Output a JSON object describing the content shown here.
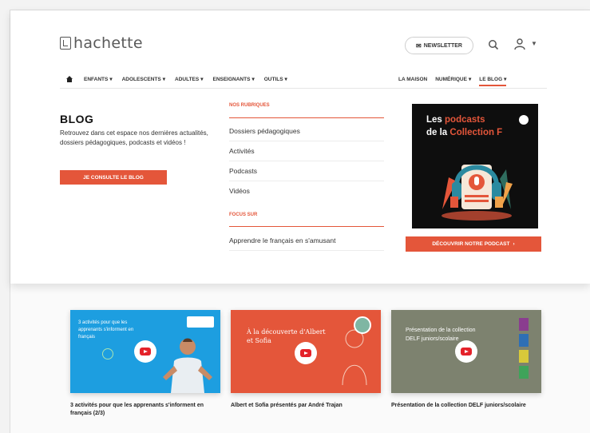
{
  "header": {
    "logo_text": "hachette",
    "newsletter_label": "NEWSLETTER",
    "nav_left": [
      {
        "label": "ENFANTS"
      },
      {
        "label": "ADOLESCENTS"
      },
      {
        "label": "ADULTES"
      },
      {
        "label": "ENSEIGNANTS"
      },
      {
        "label": "OUTILS"
      }
    ],
    "nav_right": [
      {
        "label": "LA MAISON"
      },
      {
        "label": "NUMÉRIQUE"
      },
      {
        "label": "LE BLOG"
      }
    ]
  },
  "mega_menu": {
    "blog_title": "BLOG",
    "blog_description": "Retrouvez dans cet espace nos dernières actualités, dossiers pédagogiques, podcasts et vidéos !",
    "blog_button": "JE CONSULTE LE BLOG",
    "section1_heading": "NOS RUBRIQUES",
    "section1_links": [
      "Dossiers pédagogiques",
      "Activités",
      "Podcasts",
      "Vidéos"
    ],
    "section2_heading": "FOCUS SUR",
    "section2_links": [
      "Apprendre le français en s'amusant"
    ],
    "podcast": {
      "line1_prefix": "Les ",
      "line1_highlight": "podcasts",
      "line2_prefix": "de la ",
      "line2_highlight": "Collection F",
      "button_label": "DÉCOUVRIR NOTRE PODCAST"
    }
  },
  "videos": [
    {
      "title": "3 activités pour que les apprenants s'informent en français (2/3)",
      "thumb_text": "3 activités pour que les apprenants s'informent en français",
      "color": "#1d9ee0"
    },
    {
      "title": "Albert et Sofia présentés par André Trajan",
      "thumb_text": "À la découverte d'Albert et Sofia",
      "color": "#e4563a"
    },
    {
      "title": "Présentation de la collection DELF juniors/scolaire",
      "thumb_text": "Présentation de la collection DELF juniors/scolaire",
      "color": "#7d826f"
    }
  ],
  "colors": {
    "accent": "#e4563a",
    "video_blue": "#1d9ee0",
    "video_olive": "#7d826f"
  }
}
